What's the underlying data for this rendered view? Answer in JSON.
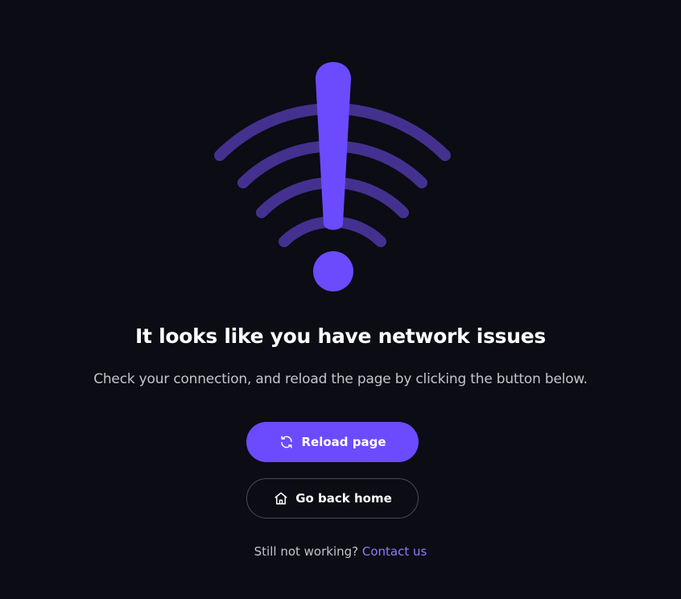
{
  "illustration": {
    "icon": "wifi-warning-icon",
    "wave_color": "#44318f",
    "accent_color": "#6c4bff"
  },
  "error": {
    "title": "It looks like you have network issues",
    "message": "Check your connection, and reload the page by clicking the button below."
  },
  "actions": {
    "reload": {
      "label": "Reload page",
      "icon": "refresh-icon"
    },
    "home": {
      "label": "Go back home",
      "icon": "home-icon"
    }
  },
  "footer": {
    "prompt": "Still not working?",
    "link": "Contact us"
  }
}
